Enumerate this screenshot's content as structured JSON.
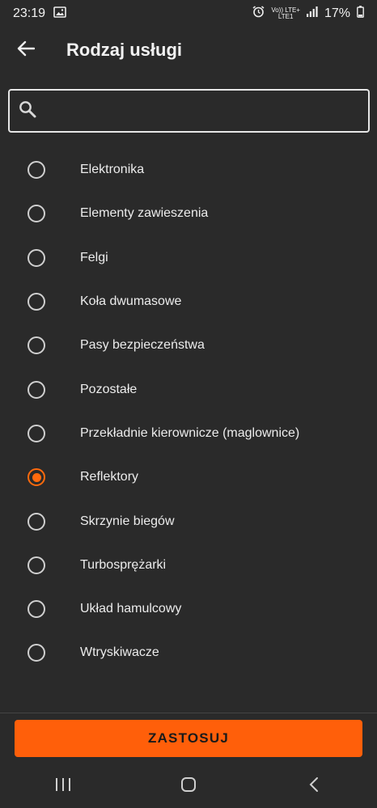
{
  "status_bar": {
    "time": "23:19",
    "network_top": "Vo)) LTE+",
    "network_bottom": "LTE1",
    "battery": "17%",
    "icons": [
      "gallery-icon",
      "alarm-icon",
      "signal-icon",
      "battery-icon"
    ]
  },
  "app_bar": {
    "title": "Rodzaj usługi",
    "back_icon": "arrow-left-icon"
  },
  "search": {
    "value": "",
    "placeholder": "",
    "icon": "search-icon"
  },
  "options": [
    {
      "label": "Elektronika",
      "selected": false
    },
    {
      "label": "Elementy zawieszenia",
      "selected": false
    },
    {
      "label": "Felgi",
      "selected": false
    },
    {
      "label": "Koła dwumasowe",
      "selected": false
    },
    {
      "label": "Pasy bezpieczeństwa",
      "selected": false
    },
    {
      "label": "Pozostałe",
      "selected": false
    },
    {
      "label": "Przekładnie kierownicze (maglownice)",
      "selected": false
    },
    {
      "label": "Reflektory",
      "selected": true
    },
    {
      "label": "Skrzynie biegów",
      "selected": false
    },
    {
      "label": "Turbosprężarki",
      "selected": false
    },
    {
      "label": "Układ hamulcowy",
      "selected": false
    },
    {
      "label": "Wtryskiwacze",
      "selected": false
    }
  ],
  "footer": {
    "apply_label": "ZASTOSUJ"
  },
  "nav_bar": {
    "icons": [
      "recent-apps-icon",
      "home-icon",
      "back-icon"
    ]
  },
  "colors": {
    "accent": "#ff5f0a",
    "background": "#2a2a2a"
  }
}
